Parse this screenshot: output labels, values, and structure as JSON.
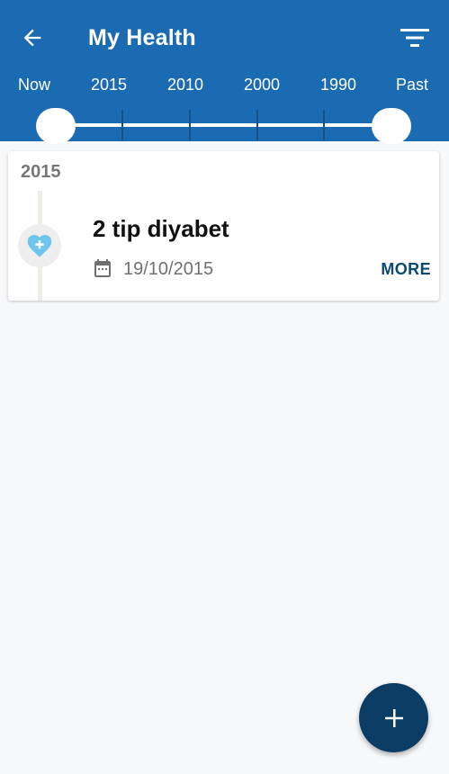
{
  "header": {
    "title": "My Health",
    "back_icon": "arrow-left-icon",
    "filter_icon": "filter-icon",
    "background_color": "#1b6bb3"
  },
  "timeline_range": {
    "labels": [
      "Now",
      "2015",
      "2010",
      "2000",
      "1990",
      "Past"
    ],
    "selected_start": "Now",
    "selected_end": "Past"
  },
  "records": [
    {
      "year": "2015",
      "title": "2 tip diyabet",
      "date": "19/10/2015",
      "icon": "heart-plus-icon",
      "more_label": "MORE"
    }
  ],
  "fab": {
    "icon": "plus-icon",
    "color": "#0b3d64"
  },
  "colors": {
    "accent": "#0d4a73",
    "heart": "#6ec6ef"
  }
}
